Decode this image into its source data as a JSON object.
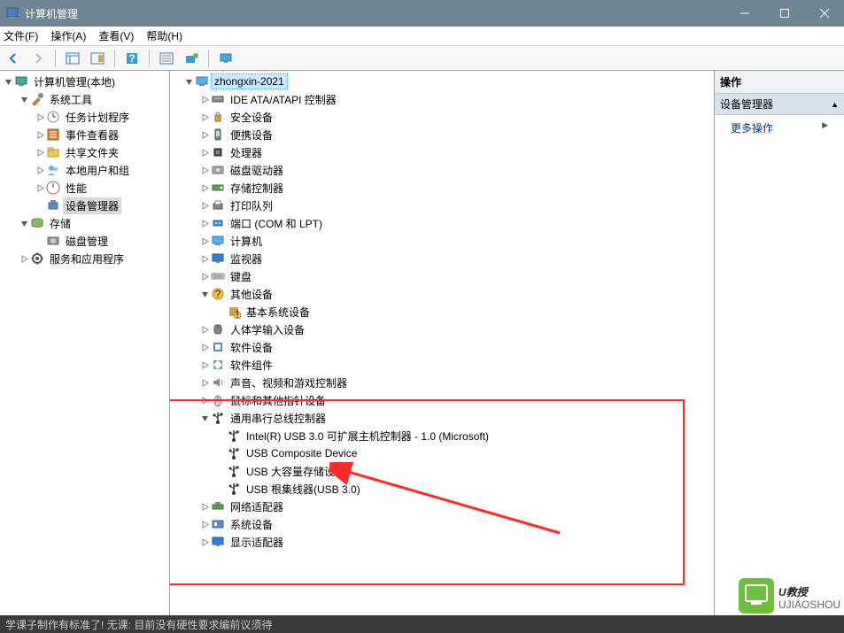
{
  "window": {
    "title": "计算机管理"
  },
  "menu": {
    "file": "文件(F)",
    "action": "操作(A)",
    "view": "查看(V)",
    "help": "帮助(H)"
  },
  "leftTree": [
    {
      "level": 0,
      "expand": "open",
      "icon": "computer-mgmt",
      "label": "计算机管理(本地)"
    },
    {
      "level": 1,
      "expand": "open",
      "icon": "system-tools",
      "label": "系统工具"
    },
    {
      "level": 2,
      "expand": "closed",
      "icon": "task-scheduler",
      "label": "任务计划程序"
    },
    {
      "level": 2,
      "expand": "closed",
      "icon": "event-viewer",
      "label": "事件查看器"
    },
    {
      "level": 2,
      "expand": "closed",
      "icon": "shared-folders",
      "label": "共享文件夹"
    },
    {
      "level": 2,
      "expand": "closed",
      "icon": "users-groups",
      "label": "本地用户和组"
    },
    {
      "level": 2,
      "expand": "closed",
      "icon": "performance",
      "label": "性能"
    },
    {
      "level": 2,
      "expand": "none",
      "icon": "device-manager",
      "label": "设备管理器",
      "selected": true
    },
    {
      "level": 1,
      "expand": "open",
      "icon": "storage",
      "label": "存储"
    },
    {
      "level": 2,
      "expand": "none",
      "icon": "disk-mgmt",
      "label": "磁盘管理"
    },
    {
      "level": 1,
      "expand": "closed",
      "icon": "services",
      "label": "服务和应用程序"
    }
  ],
  "centerTree": [
    {
      "level": 0,
      "expand": "open",
      "icon": "computer",
      "label": "zhongxin-2021",
      "selected": true
    },
    {
      "level": 1,
      "expand": "closed",
      "icon": "ide",
      "label": "IDE ATA/ATAPI 控制器"
    },
    {
      "level": 1,
      "expand": "closed",
      "icon": "security",
      "label": "安全设备"
    },
    {
      "level": 1,
      "expand": "closed",
      "icon": "portable",
      "label": "便携设备"
    },
    {
      "level": 1,
      "expand": "closed",
      "icon": "cpu",
      "label": "处理器"
    },
    {
      "level": 1,
      "expand": "closed",
      "icon": "disk-drive",
      "label": "磁盘驱动器"
    },
    {
      "level": 1,
      "expand": "closed",
      "icon": "storage-ctrl",
      "label": "存储控制器"
    },
    {
      "level": 1,
      "expand": "closed",
      "icon": "print-queue",
      "label": "打印队列"
    },
    {
      "level": 1,
      "expand": "closed",
      "icon": "ports",
      "label": "端口 (COM 和 LPT)"
    },
    {
      "level": 1,
      "expand": "closed",
      "icon": "computer-item",
      "label": "计算机"
    },
    {
      "level": 1,
      "expand": "closed",
      "icon": "monitor",
      "label": "监视器"
    },
    {
      "level": 1,
      "expand": "closed",
      "icon": "keyboard",
      "label": "键盘"
    },
    {
      "level": 1,
      "expand": "open",
      "icon": "other",
      "label": "其他设备"
    },
    {
      "level": 2,
      "expand": "none",
      "icon": "unknown",
      "label": "基本系统设备"
    },
    {
      "level": 1,
      "expand": "closed",
      "icon": "hid",
      "label": "人体学输入设备"
    },
    {
      "level": 1,
      "expand": "closed",
      "icon": "software-dev",
      "label": "软件设备"
    },
    {
      "level": 1,
      "expand": "closed",
      "icon": "software-comp",
      "label": "软件组件"
    },
    {
      "level": 1,
      "expand": "closed",
      "icon": "audio",
      "label": "声音、视频和游戏控制器"
    },
    {
      "level": 1,
      "expand": "closed",
      "icon": "mouse",
      "label": "鼠标和其他指针设备"
    },
    {
      "level": 1,
      "expand": "open",
      "icon": "usb",
      "label": "通用串行总线控制器"
    },
    {
      "level": 2,
      "expand": "none",
      "icon": "usb-item",
      "label": "Intel(R) USB 3.0 可扩展主机控制器 - 1.0 (Microsoft)"
    },
    {
      "level": 2,
      "expand": "none",
      "icon": "usb-item",
      "label": "USB Composite Device"
    },
    {
      "level": 2,
      "expand": "none",
      "icon": "usb-item",
      "label": "USB 大容量存储设备"
    },
    {
      "level": 2,
      "expand": "none",
      "icon": "usb-item",
      "label": "USB 根集线器(USB 3.0)"
    },
    {
      "level": 1,
      "expand": "closed",
      "icon": "network",
      "label": "网络适配器"
    },
    {
      "level": 1,
      "expand": "closed",
      "icon": "system-dev",
      "label": "系统设备"
    },
    {
      "level": 1,
      "expand": "closed",
      "icon": "display",
      "label": "显示适配器"
    }
  ],
  "rightPane": {
    "header": "操作",
    "section": "设备管理器",
    "link": "更多操作"
  },
  "bottomStrip": "学课子制作有标准了! 无课: 目前没有硬性要求编前议须待",
  "watermark": {
    "line1": "U教授",
    "line2": "UJIAOSHOU.COM"
  }
}
